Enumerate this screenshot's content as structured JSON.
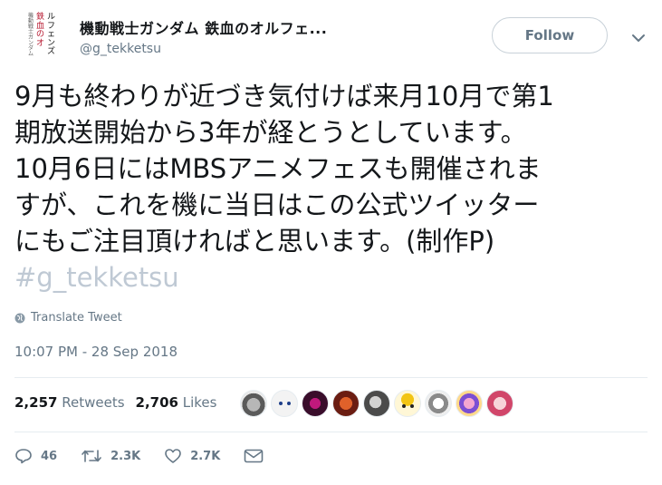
{
  "account": {
    "display_name": "機動戦士ガンダム 鉄血のオルフェ...",
    "handle": "@g_tekketsu",
    "avatar_logo_text": "機動戦士ガンダム 鉄血のオルフェンズ"
  },
  "follow_button": {
    "label": "Follow"
  },
  "tweet": {
    "lines": [
      "9月も終わりが近づき気付けば来月10月で第1",
      "期放送開始から3年が経とうとしています。",
      "10月6日にはMBSアニメフェスも開催されま",
      "すが、これを機に当日はこの公式ツイッター",
      "にもご注目頂ければと思います。(制作P)"
    ],
    "hashtag": "#g_tekketsu"
  },
  "translate": {
    "label": "Translate Tweet"
  },
  "timestamp": "10:07 PM - 28 Sep 2018",
  "stats": {
    "retweets_count": "2,257",
    "retweets_label": "Retweets",
    "likes_count": "2,706",
    "likes_label": "Likes"
  },
  "actions": {
    "reply_count": "46",
    "retweet_count": "2.3K",
    "like_count": "2.7K"
  },
  "icons": {
    "chevron": "chevron-down-icon",
    "globe": "globe-icon",
    "reply": "reply-icon",
    "retweet": "retweet-icon",
    "like": "heart-icon",
    "message": "envelope-icon"
  },
  "colors": {
    "text": "#14171a",
    "secondary": "#657786",
    "hashtag": "#bfc9d4",
    "divider": "#e6ecf0",
    "logo_accent": "#b5132b"
  }
}
